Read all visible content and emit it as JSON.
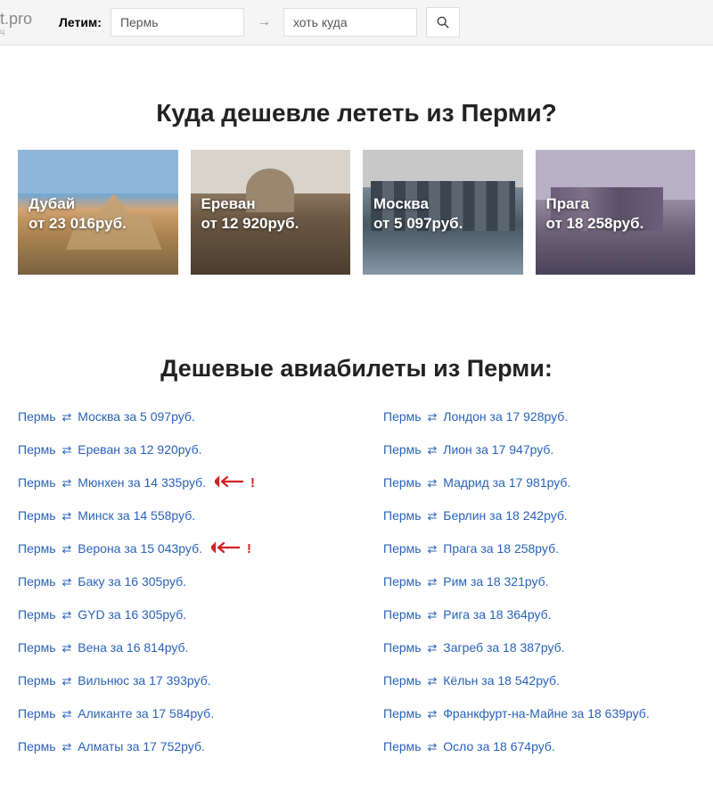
{
  "header": {
    "logo": "t.pro",
    "logo_sub": "ц",
    "fly_label": "Летим:",
    "from_value": "Пермь",
    "arrow": "→",
    "to_value": "хоть куда"
  },
  "heading1": "Куда дешевле лететь из Перми?",
  "cards": [
    {
      "city": "Дубай",
      "price": "от 23 016руб."
    },
    {
      "city": "Ереван",
      "price": "от 12 920руб."
    },
    {
      "city": "Москва",
      "price": "от 5 097руб."
    },
    {
      "city": "Прага",
      "price": "от 18 258руб."
    }
  ],
  "heading2": "Дешевые авиабилеты из Перми:",
  "routes_left": [
    {
      "from": "Пермь",
      "to": "Москва",
      "price": "5 097руб.",
      "highlight": false
    },
    {
      "from": "Пермь",
      "to": "Ереван",
      "price": "12 920руб.",
      "highlight": false
    },
    {
      "from": "Пермь",
      "to": "Мюнхен",
      "price": "14 335руб.",
      "highlight": true
    },
    {
      "from": "Пермь",
      "to": "Минск",
      "price": "14 558руб.",
      "highlight": false
    },
    {
      "from": "Пермь",
      "to": "Верона",
      "price": "15 043руб.",
      "highlight": true
    },
    {
      "from": "Пермь",
      "to": "Баку",
      "price": "16 305руб.",
      "highlight": false
    },
    {
      "from": "Пермь",
      "to": "GYD",
      "price": "16 305руб.",
      "highlight": false
    },
    {
      "from": "Пермь",
      "to": "Вена",
      "price": "16 814руб.",
      "highlight": false
    },
    {
      "from": "Пермь",
      "to": "Вильнюс",
      "price": "17 393руб.",
      "highlight": false
    },
    {
      "from": "Пермь",
      "to": "Аликанте",
      "price": "17 584руб.",
      "highlight": false
    },
    {
      "from": "Пермь",
      "to": "Алматы",
      "price": "17 752руб.",
      "highlight": false
    }
  ],
  "routes_right": [
    {
      "from": "Пермь",
      "to": "Лондон",
      "price": "17 928руб.",
      "highlight": false
    },
    {
      "from": "Пермь",
      "to": "Лион",
      "price": "17 947руб.",
      "highlight": false
    },
    {
      "from": "Пермь",
      "to": "Мадрид",
      "price": "17 981руб.",
      "highlight": false
    },
    {
      "from": "Пермь",
      "to": "Берлин",
      "price": "18 242руб.",
      "highlight": false
    },
    {
      "from": "Пермь",
      "to": "Прага",
      "price": "18 258руб.",
      "highlight": false
    },
    {
      "from": "Пермь",
      "to": "Рим",
      "price": "18 321руб.",
      "highlight": false
    },
    {
      "from": "Пермь",
      "to": "Рига",
      "price": "18 364руб.",
      "highlight": false
    },
    {
      "from": "Пермь",
      "to": "Загреб",
      "price": "18 387руб.",
      "highlight": false
    },
    {
      "from": "Пермь",
      "to": "Кёльн",
      "price": "18 542руб.",
      "highlight": false
    },
    {
      "from": "Пермь",
      "to": "Франкфурт-на-Майне",
      "price": "18 639руб.",
      "highlight": false
    },
    {
      "from": "Пермь",
      "to": "Осло",
      "price": "18 674руб.",
      "highlight": false
    }
  ],
  "za": "за"
}
